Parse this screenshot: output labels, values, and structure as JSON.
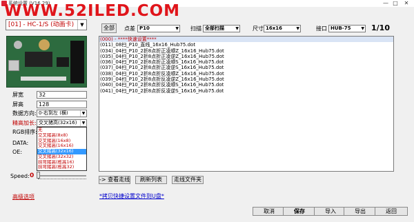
{
  "window": {
    "title": "系统设置 (V16.29)",
    "controls": [
      "—",
      "□",
      "✕"
    ]
  },
  "watermark": "WWW.52ILED.COM",
  "left_panel": {
    "model": "[01] - HC-1/S (动画卡)",
    "width_label": "屏宽",
    "width_value": "32",
    "height_label": "屏高",
    "height_value": "128",
    "direction_label": "数据方向:",
    "direction_value": "0-右到左 (横)",
    "scan_label": "精高加长:",
    "scan_value": "交叉猪高(32x16)",
    "rgb_label": "RGB排序:",
    "data_label": "DATA:",
    "oe_label": "OE:",
    "dropdown_options": [
      "无",
      "交叉猪高(8x8)",
      "交叉猪高(16x8)",
      "交叉猪高(16x16)",
      "交叉猪高(32x16)",
      "交叉猪高(32x32)",
      "拐弯猪高(栋高16)",
      "拐弯猪高(栋高32)"
    ],
    "selected_option_index": 4,
    "speed_label": "Speed:",
    "speed_value": "0",
    "advanced_link": "高级选项"
  },
  "toolbar": {
    "all_button": "全部",
    "point_label": "点差",
    "point_value": "P10",
    "scan_label": "扫描",
    "scan_value": "全部扫描",
    "size_label": "尺寸",
    "size_value": "16x16",
    "port_label": "接口",
    "port_value": "HUB-75",
    "page_indicator": "1/10"
  },
  "list": {
    "items": [
      "(000) - ****快速设置****",
      "(011)_08扫_P10_直线_16x16_Hub75.dot",
      "(034)_04扫_P10_2折8点折正凌顺Z_16x16_Hub75.dot",
      "(035)_04扫_P10_2折8点折正凌逆Z_16x16_Hub75.dot",
      "(036)_04扫_P10_2折8点折正凌顺S_16x16_Hub75.dot",
      "(037)_04扫_P10_2折8点折正凌逆S_16x16_Hub75.dot",
      "(038)_04扫_P10_2折8点折反凌顺Z_16x16_Hub75.dot",
      "(039)_04扫_P10_2折8点折反凌逆Z_16x16_Hub75.dot",
      "(040)_04扫_P10_2折8点折反凌顺S_16x16_Hub75.dot",
      "(041)_04扫_P10_2折8点折反凌逆S_16x16_Hub75.dot"
    ]
  },
  "list_actions": {
    "view_trace": "-> 查看走线",
    "refresh": "刷新列表",
    "trace_folder": "走线文件夹"
  },
  "bottom": {
    "copy_link": "*拷贝快捷设置文件到U盘*",
    "cancel": "取消",
    "save": "保存",
    "import": "导入",
    "export": "导出",
    "back": "返回"
  },
  "colors": {
    "accent_red": "#c00000",
    "selection_blue": "#3399ff",
    "watermark_red": "#e0151b"
  }
}
